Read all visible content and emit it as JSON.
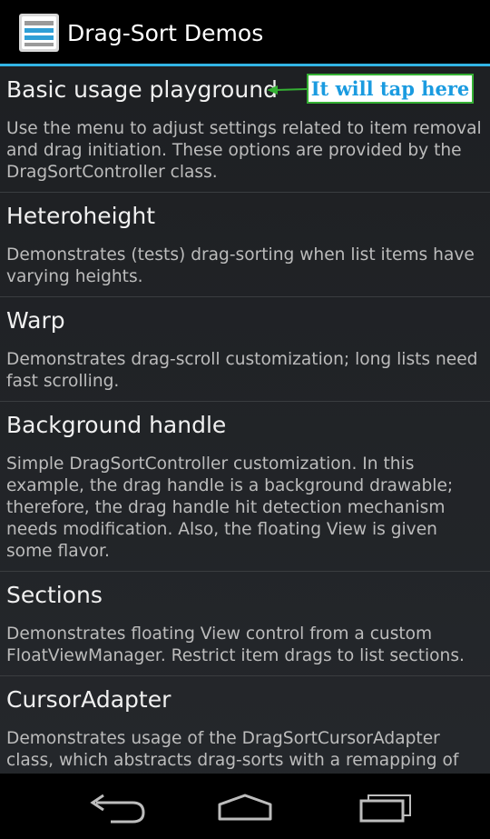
{
  "action_bar": {
    "title": "Drag-Sort Demos",
    "icon": "list-lines-icon",
    "accent_color": "#33b5e5"
  },
  "list": {
    "items": [
      {
        "title": "Basic usage playground",
        "description": "Use the menu to adjust settings related to item removal and drag initiation. These options are provided by the DragSortController class."
      },
      {
        "title": "Heteroheight",
        "description": "Demonstrates (tests) drag-sorting when list items have varying heights."
      },
      {
        "title": "Warp",
        "description": "Demonstrates drag-scroll customization; long lists need fast scrolling."
      },
      {
        "title": "Background handle",
        "description": "Simple DragSortController customization. In this example, the drag handle is a background drawable; therefore, the drag handle hit detection mechanism needs modification. Also, the floating View is given some flavor."
      },
      {
        "title": "Sections",
        "description": "Demonstrates floating View control from a custom FloatViewManager. Restrict item drags to list sections."
      },
      {
        "title": "CursorAdapter",
        "description": "Demonstrates usage of the DragSortCursorAdapter class, which abstracts drag-sorts with a remapping of"
      }
    ]
  },
  "annotation": {
    "text": "It will tap here",
    "text_color": "#1a9be0",
    "border_color": "#35b034"
  },
  "nav_bar": {
    "back_icon": "back-icon",
    "home_icon": "home-icon",
    "recents_icon": "recents-icon"
  }
}
